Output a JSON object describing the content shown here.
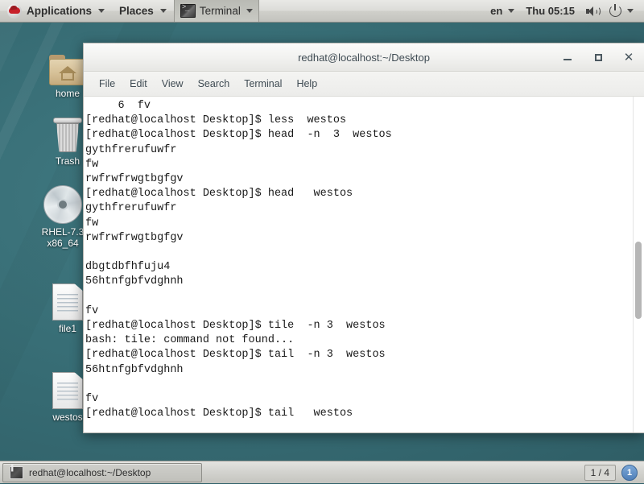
{
  "topbar": {
    "logo_icon": "redhat-logo-icon",
    "applications_label": "Applications",
    "places_label": "Places",
    "window_button_label": "Terminal",
    "window_button_icon": "terminal-icon",
    "keyboard_layout": "en",
    "clock": "Thu 05:15",
    "volume_icon": "speaker-icon",
    "power_icon": "power-icon"
  },
  "desktop": {
    "background_color": "#386e76",
    "icons": [
      {
        "label": "home",
        "icon": "home-folder-icon"
      },
      {
        "label": "Trash",
        "icon": "trash-icon"
      },
      {
        "label": "RHEL-7.3\nx86_64",
        "icon": "cd-disc-icon"
      },
      {
        "label": "file1",
        "icon": "text-file-icon"
      },
      {
        "label": "westos",
        "icon": "text-file-icon"
      }
    ]
  },
  "terminal": {
    "title": "redhat@localhost:~/Desktop",
    "window_buttons": {
      "minimize": "minimize-icon",
      "maximize": "maximize-icon",
      "close": "close-icon"
    },
    "menu": [
      "File",
      "Edit",
      "View",
      "Search",
      "Terminal",
      "Help"
    ],
    "content": "     6  fv\n[redhat@localhost Desktop]$ less  westos\n[redhat@localhost Desktop]$ head  -n  3  westos\ngythfrerufuwfr\nfw\nrwfrwfrwgtbgfgv\n[redhat@localhost Desktop]$ head   westos\ngythfrerufuwfr\nfw\nrwfrwfrwgtbgfgv\n\ndbgtdbfhfuju4\n56htnfgbfvdghnh\n\nfv\n[redhat@localhost Desktop]$ tile  -n 3  westos\nbash: tile: command not found...\n[redhat@localhost Desktop]$ tail  -n 3  westos\n56htnfgbfvdghnh\n\nfv\n[redhat@localhost Desktop]$ tail   westos"
  },
  "taskbar": {
    "window_title": "redhat@localhost:~/Desktop",
    "window_icon": "terminal-icon",
    "workspace_count": "1 / 4",
    "workspace_badge": "1"
  }
}
